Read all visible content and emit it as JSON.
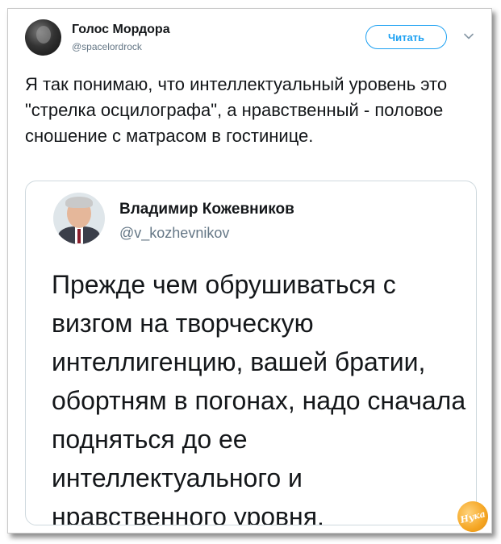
{
  "tweet": {
    "author_name": "Голос Мордора",
    "author_handle": "@spacelordrock",
    "follow_label": "Читать",
    "text": "Я так понимаю, что интеллектуальный уровень это \"стрелка осцилографа\", а нравственный - половое сношение с матрасом в гостинице."
  },
  "quoted_tweet": {
    "author_name": "Владимир Кожевников",
    "author_handle": "@v_kozhevnikov",
    "text": "Прежде чем обрушиваться с визгом на творческую интеллигенцию, вашей братии, обортням в погонах, надо сначала подняться до ее интеллектуального и нравственного уровня."
  },
  "watermark": {
    "text": "Нука"
  },
  "icons": {
    "menu": "chevron-down-icon",
    "avatar": "avatar",
    "quoted_avatar": "avatar"
  },
  "colors": {
    "accent": "#1da1f2",
    "text": "#14171a",
    "secondary_text": "#657786",
    "border": "#cfd9de",
    "watermark": "#f5a623"
  }
}
